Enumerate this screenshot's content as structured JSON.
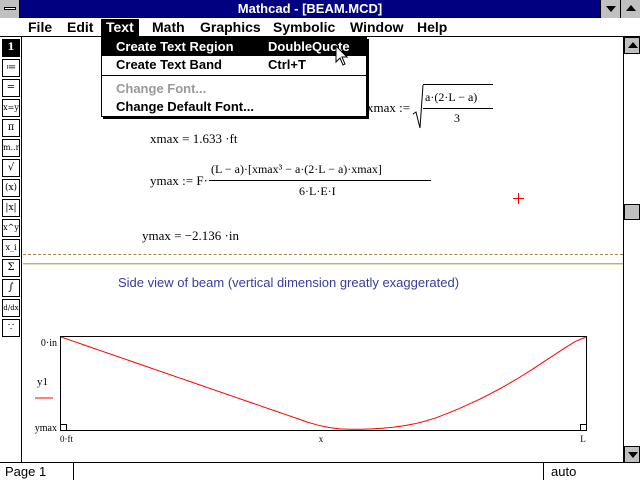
{
  "window": {
    "title": "Mathcad - [BEAM.MCD]"
  },
  "menubar": {
    "items": [
      "File",
      "Edit",
      "Text",
      "Math",
      "Graphics",
      "Symbolic",
      "Window",
      "Help"
    ]
  },
  "dropdown": {
    "items": [
      {
        "label": "Create Text Region",
        "accel": "DoubleQuote",
        "selected": true,
        "disabled": false
      },
      {
        "label": "Create Text Band",
        "accel": "Ctrl+T",
        "selected": false,
        "disabled": false
      },
      {
        "label": "Change Font...",
        "accel": "",
        "selected": false,
        "disabled": true
      },
      {
        "label": "Change Default Font...",
        "accel": "",
        "selected": false,
        "disabled": false
      }
    ]
  },
  "palette": {
    "buttons": [
      "1",
      "≔",
      "=",
      "x=y",
      "π",
      "m..n",
      "√",
      "(x)",
      "|x|",
      "x^y",
      "x_i",
      "Σ",
      "∫",
      "d/dx",
      "∵"
    ]
  },
  "worksheet": {
    "xmax_def": {
      "lhs": "xmax :=",
      "num": "a·(2·L − a)",
      "den": "3"
    },
    "xmax_result": "xmax = 1.633 ·ft",
    "ymax_def": {
      "lhs": "ymax := F·",
      "num": "(L − a)·[xmax³ − a·(2·L − a)·xmax]",
      "den": "6·L·E·I"
    },
    "ymax_result": "ymax = −2.136 ·in",
    "caption": "Side view of beam (vertical dimension greatly exaggerated)"
  },
  "chart_data": {
    "type": "line",
    "series": [
      {
        "name": "y1",
        "values": [
          0,
          -0.0859,
          -0.1719,
          -0.2578,
          -0.3438,
          -0.4297,
          -0.5156,
          -0.6016,
          -0.6875,
          -0.7734,
          -0.8594,
          -0.9453,
          -1.0313,
          -1.1172,
          -1.2031,
          -1.2891,
          -1.375,
          -1.4609,
          -1.5469,
          -1.6328,
          -1.7188,
          -1.8047,
          -1.8906,
          -1.9766,
          -2.0469,
          -2.1016,
          -2.1328,
          -2.1406,
          -2.1406,
          -2.1328,
          -2.1172,
          -2.0938,
          -2.0625,
          -2.0156,
          -1.9531,
          -1.875,
          -1.7813,
          -1.6797,
          -1.5703,
          -1.4531,
          -1.3281,
          -1.1953,
          -1.0547,
          -0.9063,
          -0.75,
          -0.5859,
          -0.4219,
          -0.2578,
          -0.1016,
          0
        ]
      }
    ],
    "x_labels": [
      "0·ft",
      "x",
      "L"
    ],
    "y_labels": [
      "0·in",
      "ymax"
    ],
    "legend_label": "y1",
    "ylim": [
      -2.136,
      0
    ],
    "grid": false,
    "legend_position": "left",
    "line_color": "#ff0000"
  },
  "scrollbar": {
    "thumb_position": 0.4
  },
  "statusbar": {
    "page": "Page 1",
    "mode": "auto"
  },
  "colors": {
    "title_bg": "#000080",
    "caption": "#3a3a9f",
    "plot_line": "#ff0000",
    "rule": "#c7b26a"
  }
}
